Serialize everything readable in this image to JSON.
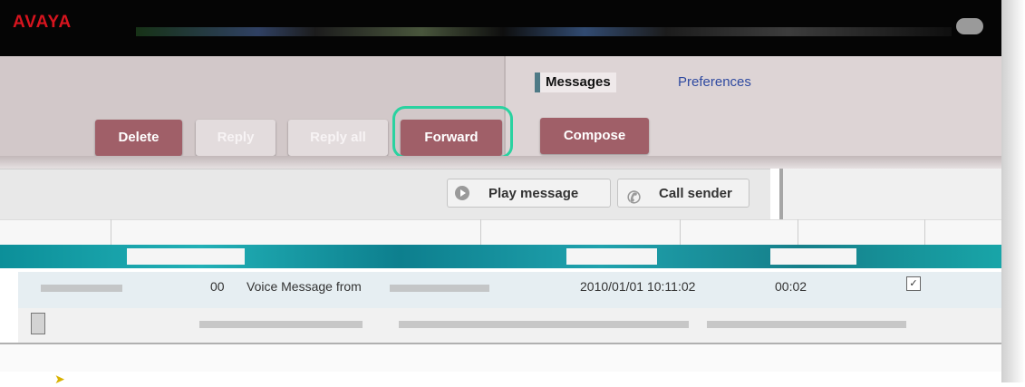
{
  "brand": {
    "logo_text": "AVAYA"
  },
  "tabs": {
    "messages": "Messages",
    "preferences": "Preferences"
  },
  "toolbar": {
    "delete": "Delete",
    "reply": "Reply",
    "reply_all": "Reply all",
    "forward": "Forward",
    "compose": "Compose"
  },
  "actions": {
    "play_message": "Play message",
    "call_sender": "Call sender"
  },
  "message_row": {
    "duration": "00",
    "subject": "Voice Message from",
    "received": "2010/01/01 10:11:02",
    "length": "00:02"
  },
  "colors": {
    "accent_maroon": "#a05f68",
    "highlight_ring": "#2ad2a0",
    "teal_bar": "#12a0a8"
  }
}
